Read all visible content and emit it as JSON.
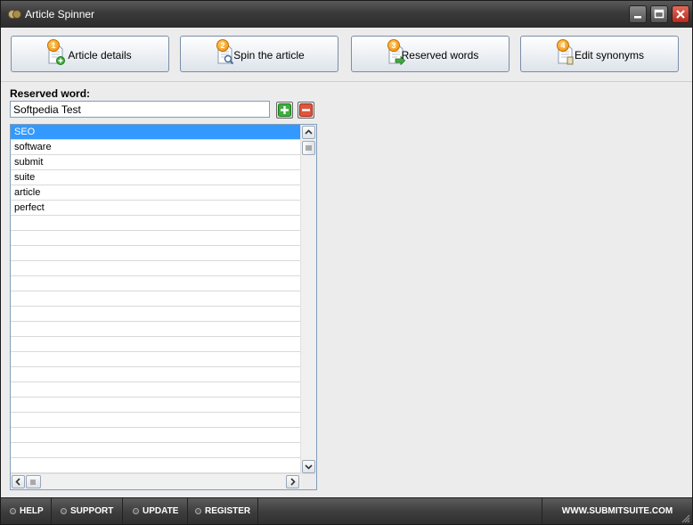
{
  "window": {
    "title": "Article Spinner"
  },
  "toolbar": {
    "buttons": [
      {
        "number": "1",
        "label": "Article details"
      },
      {
        "number": "2",
        "label": "Spin the article"
      },
      {
        "number": "3",
        "label": "Reserved words"
      },
      {
        "number": "4",
        "label": "Edit synonyms"
      }
    ]
  },
  "reserved": {
    "label": "Reserved word:",
    "input_value": "Softpedia Test",
    "words": [
      "SEO",
      "software",
      "submit",
      "suite",
      "article",
      "perfect"
    ],
    "selected_index": 0
  },
  "statusbar": {
    "links": [
      "HELP",
      "SUPPORT",
      "UPDATE",
      "REGISTER"
    ],
    "website": "WWW.SUBMITSUITE.COM"
  },
  "colors": {
    "selection": "#3399ff",
    "titlebar": "#3a3a3a",
    "close_button": "#c8392b",
    "add_icon": "#2e9e2e",
    "remove_icon": "#d9432f"
  }
}
